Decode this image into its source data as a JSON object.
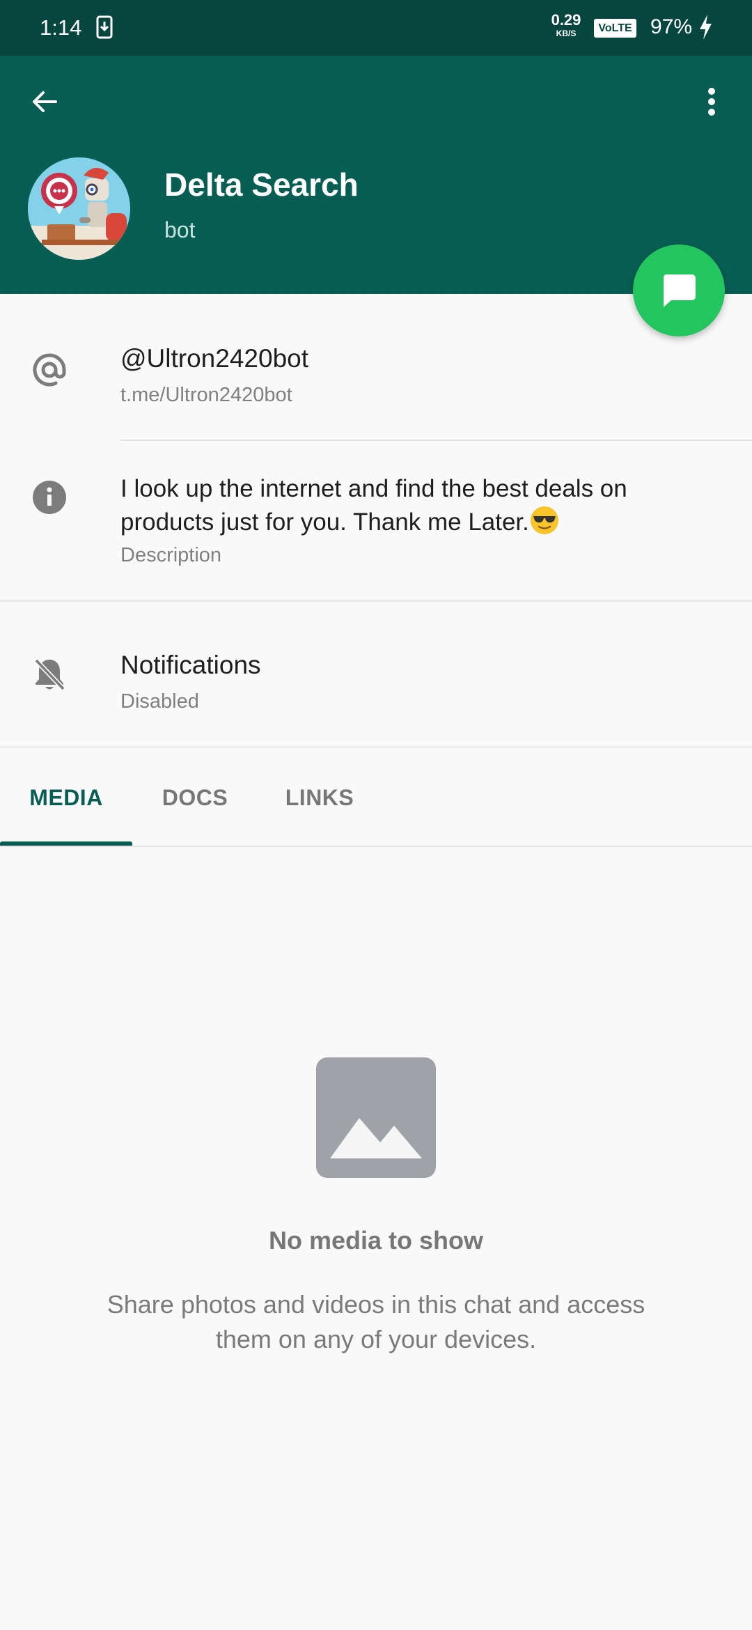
{
  "status_bar": {
    "time": "1:14",
    "net_speed": "0.29",
    "net_unit": "KB/S",
    "volte": "VoLTE",
    "battery": "97%"
  },
  "header": {
    "bot_name": "Delta Search",
    "subtitle": "bot",
    "colors": {
      "header_bg": "#085e53",
      "status_bg": "#07463f",
      "fab": "#22c55e"
    }
  },
  "info": {
    "username": "@Ultron2420bot",
    "link": "t.me/Ultron2420bot",
    "description": "I look up the internet and find the best deals on products just for you. Thank me Later.",
    "description_emoji": "smiling-face-with-sunglasses",
    "description_label": "Description",
    "notifications_title": "Notifications",
    "notifications_status": "Disabled"
  },
  "tabs": [
    {
      "label": "MEDIA",
      "active": true
    },
    {
      "label": "DOCS",
      "active": false
    },
    {
      "label": "LINKS",
      "active": false
    }
  ],
  "empty_state": {
    "title": "No media to show",
    "text": "Share photos and videos in this chat and access them on any of your devices."
  },
  "icons": {
    "back": "arrow-left-icon",
    "menu": "more-vertical-icon",
    "fab": "message-icon",
    "username": "at-sign-icon",
    "description": "info-icon",
    "notifications": "bell-off-icon",
    "empty": "image-icon"
  }
}
